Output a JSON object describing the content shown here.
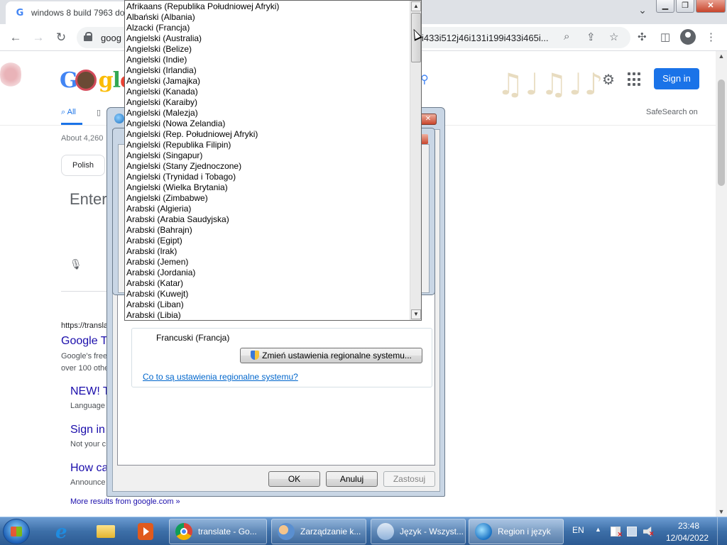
{
  "chrome": {
    "tab_title": "windows 8 build 7963 do",
    "omnibox_left": "goog",
    "omnibox_right": "i433i512j46i131i199i433i465i...",
    "win_min": "▁",
    "win_restore": "❐",
    "win_close": "✕",
    "tab_dropdown": "⌄"
  },
  "google": {
    "signin": "Sign in",
    "tab_all": "All",
    "safesearch": "SafeSearch on",
    "about": "About 4,260",
    "chip_polish": "Polish",
    "enter_text": "Enter",
    "result_url": "https://transla",
    "result_title": "Google T",
    "result_snip1": "Google's free",
    "result_snip2": "over 100 othe",
    "sub1_title": "NEW! T",
    "sub1_snip": "Language",
    "sub2_title": "Sign in",
    "sub2_snip": "Not your c",
    "sub3_title": "How ca",
    "sub3_snip": "Announce",
    "more_results": "More results from google.com »",
    "notes": "♫♩♫♩♪"
  },
  "dialog": {
    "selected_language": "Francuski (Francja)",
    "change_system_locale": "Zmień ustawienia regionalne systemu...",
    "help_link": "Co to są ustawienia regionalne systemu?",
    "ok": "OK",
    "cancel": "Anuluj",
    "apply": "Zastosuj"
  },
  "language_list": [
    "Afrikaans (Republika Południowej Afryki)",
    "Albański (Albania)",
    "Alzacki (Francja)",
    "Angielski (Australia)",
    "Angielski (Belize)",
    "Angielski (Indie)",
    "Angielski (Irlandia)",
    "Angielski (Jamajka)",
    "Angielski (Kanada)",
    "Angielski (Karaiby)",
    "Angielski (Malezja)",
    "Angielski (Nowa Zelandia)",
    "Angielski (Rep. Południowej Afryki)",
    "Angielski (Republika Filipin)",
    "Angielski (Singapur)",
    "Angielski (Stany Zjednoczone)",
    "Angielski (Trynidad i Tobago)",
    "Angielski (Wielka Brytania)",
    "Angielski (Zimbabwe)",
    "Arabski (Algieria)",
    "Arabski (Arabia Saudyjska)",
    "Arabski (Bahrajn)",
    "Arabski (Egipt)",
    "Arabski (Irak)",
    "Arabski (Jemen)",
    "Arabski (Jordania)",
    "Arabski (Katar)",
    "Arabski (Kuwejt)",
    "Arabski (Liban)",
    "Arabski (Libia)"
  ],
  "taskbar": {
    "tasks": [
      "translate - Go...",
      "Zarządzanie k...",
      "Język - Wszyst...",
      "Region i język"
    ],
    "tray_lang": "EN",
    "time": "23:48",
    "date": "12/04/2022"
  }
}
